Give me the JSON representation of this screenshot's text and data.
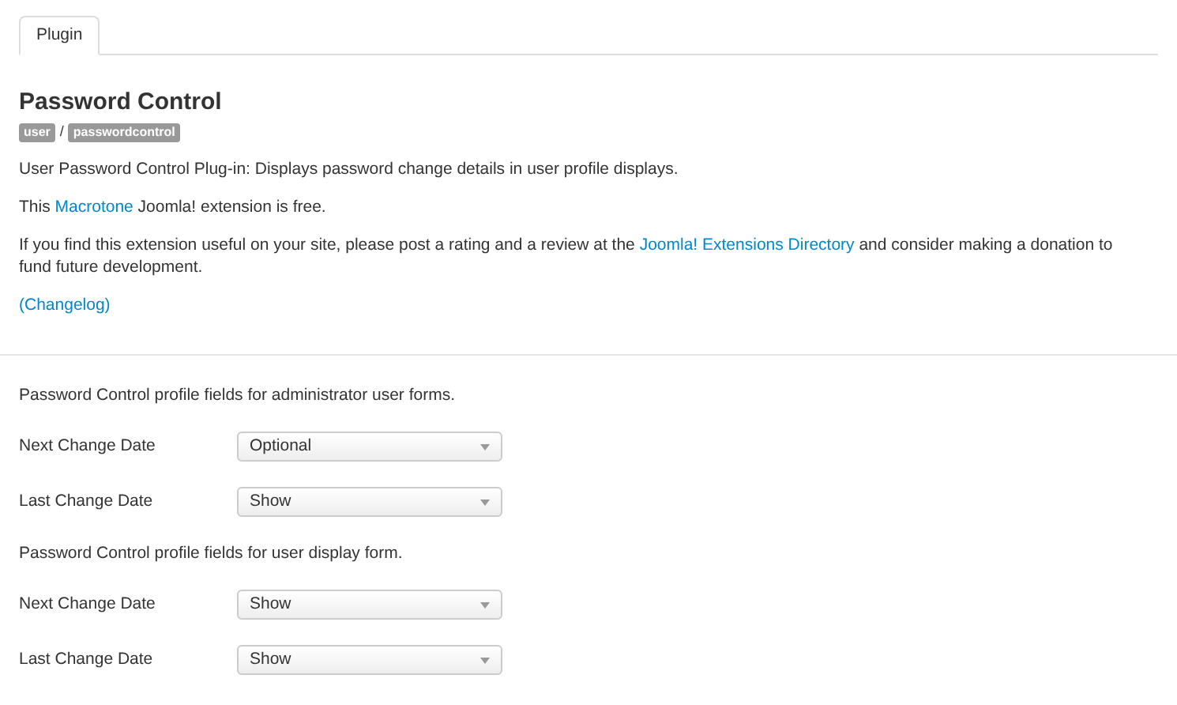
{
  "tabs": [
    {
      "label": "Plugin",
      "selected": true
    }
  ],
  "title": "Password Control",
  "badges": [
    "user",
    "passwordcontrol"
  ],
  "badge_separator": "/",
  "paragraphs": [
    [
      {
        "text": "User Password Control Plug-in: Displays password change details in user profile displays.",
        "link": false
      }
    ],
    [
      {
        "text": "This ",
        "link": false
      },
      {
        "text": "Macrotone",
        "link": true
      },
      {
        "text": " Joomla! extension is free.",
        "link": false
      }
    ],
    [
      {
        "text": "If you find this extension useful on your site, please post a rating and a review at the ",
        "link": false
      },
      {
        "text": "Joomla! Extensions Directory",
        "link": true
      },
      {
        "text": " and consider making a donation to fund future development.",
        "link": false
      }
    ],
    [
      {
        "text": "(Changelog)",
        "link": true
      }
    ]
  ],
  "sections": [
    {
      "heading": "Password Control profile fields for administrator user forms.",
      "fields": [
        {
          "label": "Next Change Date",
          "value": "Optional"
        },
        {
          "label": "Last Change Date",
          "value": "Show"
        }
      ]
    },
    {
      "heading": "Password Control profile fields for user display form.",
      "fields": [
        {
          "label": "Next Change Date",
          "value": "Show"
        },
        {
          "label": "Last Change Date",
          "value": "Show"
        }
      ]
    }
  ]
}
